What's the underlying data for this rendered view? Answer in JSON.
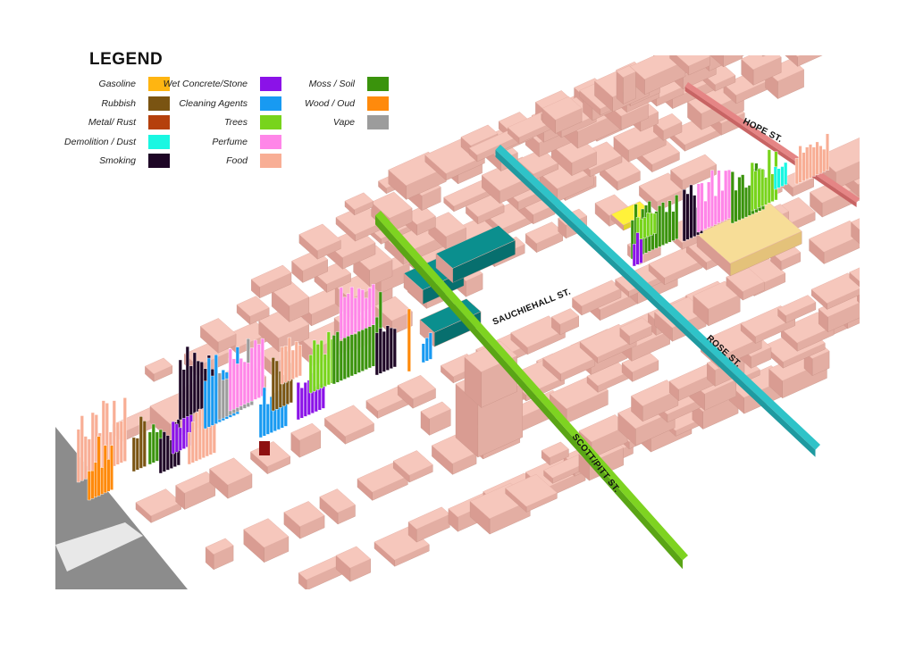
{
  "legend": {
    "title": "LEGEND",
    "items": [
      {
        "label": "Gasoline",
        "color": "#FFB511"
      },
      {
        "label": "Rubbish",
        "color": "#7A5412"
      },
      {
        "label": "Metal/ Rust",
        "color": "#B5400C"
      },
      {
        "label": "Demolition / Dust",
        "color": "#19F7E2"
      },
      {
        "label": "Smoking",
        "color": "#1E0626"
      },
      {
        "label": "Wet Concrete/Stone",
        "color": "#8B12E8"
      },
      {
        "label": "Cleaning Agents",
        "color": "#189AF2"
      },
      {
        "label": "Trees",
        "color": "#78D41C"
      },
      {
        "label": "Perfume",
        "color": "#FF86E8"
      },
      {
        "label": "Food",
        "color": "#F8AE95"
      },
      {
        "label": "Moss / Soil",
        "color": "#3A930C"
      },
      {
        "label": "Wood / Oud",
        "color": "#FF8A0C"
      },
      {
        "label": "Vape",
        "color": "#9C9C9C"
      }
    ]
  },
  "streets": {
    "hope": "HOPE ST.",
    "rose": "ROSE ST.",
    "sauchiehall": "SAUCHIEHALL ST.",
    "scott_pitt": "SCOTT/PITT ST."
  },
  "colors": {
    "building": "#F6C7BC",
    "building_side": "#E3AEA3",
    "building_shadow": "#D99C92",
    "hope_street": "#E58585",
    "rose_street": "#2FC3C8",
    "scott_street": "#7ED321",
    "teal_blocks": "#0B8F8E",
    "yellow_block": "#FFF23A",
    "cream_block": "#F7DD97",
    "asphalt": "#8C8C8C"
  }
}
